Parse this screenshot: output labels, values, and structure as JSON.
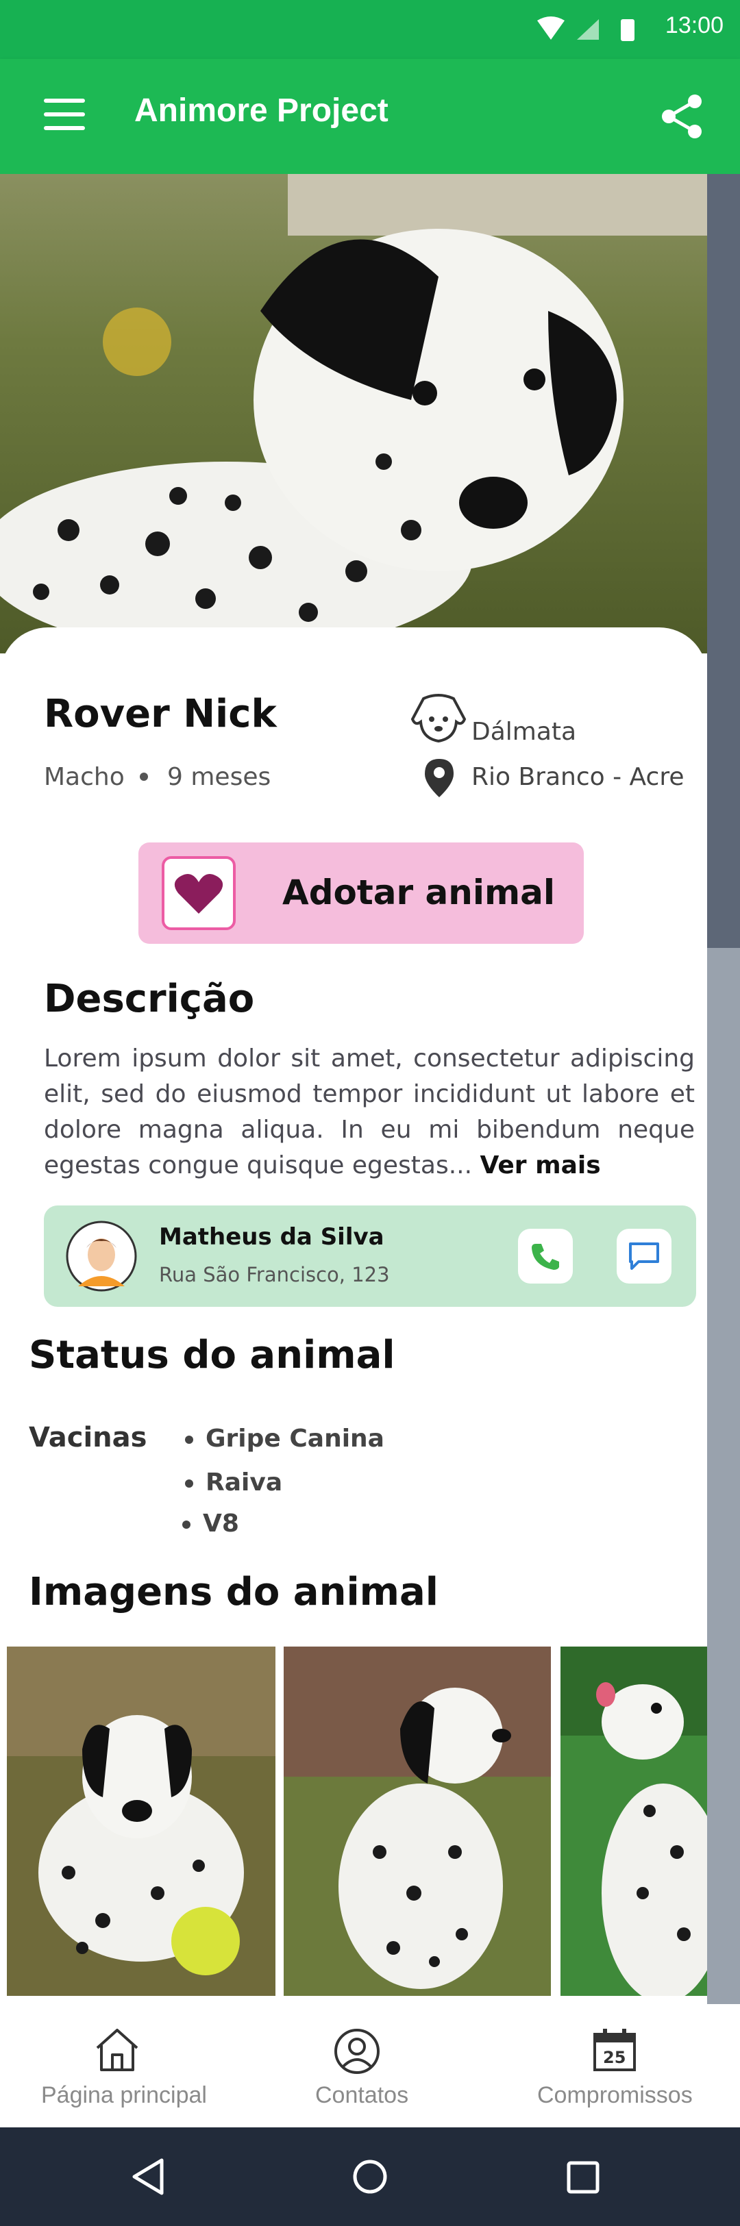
{
  "status_bar": {
    "time": "13:00"
  },
  "app_bar": {
    "title": "Animore Project"
  },
  "pet": {
    "name": "Rover Nick",
    "sex": "Macho",
    "age": "9 meses",
    "breed": "Dálmata",
    "location": "Rio Branco - Acre"
  },
  "adopt_button": {
    "label": "Adotar animal"
  },
  "description": {
    "heading": "Descrição",
    "text": "Lorem ipsum dolor sit amet, consectetur adipiscing elit, sed do eiusmod tempor incididunt ut labore et dolore magna aliqua. In eu mi bibendum neque egestas congue quisque egestas...",
    "more": "Ver mais"
  },
  "owner": {
    "name": "Matheus da Silva",
    "address": "Rua São Francisco, 123"
  },
  "status": {
    "heading": "Status do animal",
    "vaccines_label": "Vacinas",
    "vaccines": [
      "Gripe Canina",
      "Raiva",
      "V8"
    ]
  },
  "images": {
    "heading": "Imagens do animal"
  },
  "bottom_nav": {
    "items": [
      {
        "label": "Página principal"
      },
      {
        "label": "Contatos"
      },
      {
        "label": "Compromissos"
      }
    ],
    "calendar_day": "25"
  },
  "colors": {
    "primary": "#1db954",
    "adopt_bg": "#f5bddc",
    "heart": "#8b1d5c",
    "owner_card": "#c4e8d0"
  }
}
